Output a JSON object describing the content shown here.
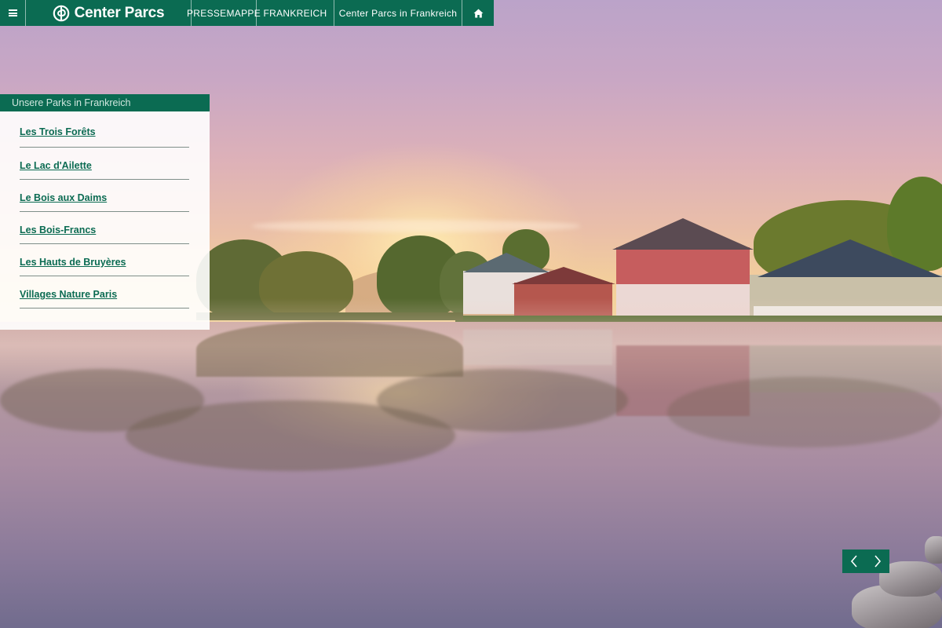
{
  "header": {
    "menu_icon": "hamburger-menu-icon",
    "logo_text": "Center Parcs",
    "logo_icon": "center-parcs-logo-icon",
    "nav": [
      {
        "label": "PRESSEMAPPE"
      },
      {
        "label": "FRANKREICH"
      },
      {
        "label": "Center Parcs in Frankreich"
      }
    ],
    "home_icon": "home-icon"
  },
  "panel": {
    "title": "Unsere Parks in Frankreich",
    "items": [
      {
        "label": "Les Trois Forêts"
      },
      {
        "label": "Le Lac d'Ailette"
      },
      {
        "label": "Le Bois aux Daims"
      },
      {
        "label": "Les Bois-Francs"
      },
      {
        "label": "Les Hauts de Bruyères"
      },
      {
        "label": "Villages Nature Paris"
      }
    ]
  },
  "slider": {
    "prev_icon": "chevron-left-icon",
    "next_icon": "chevron-right-icon"
  },
  "colors": {
    "brand": "#0b6b52",
    "panel_background": "#ffffff",
    "link": "#0b6b52"
  }
}
